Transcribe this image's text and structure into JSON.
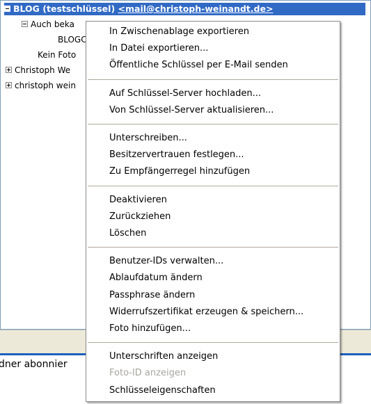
{
  "tree": {
    "rows": [
      {
        "label": "BLOG (testschlüssel)",
        "email": "<mail@christoph-weinandt.de>"
      },
      {
        "label": "Auch beka"
      },
      {
        "label": "BLOGC"
      },
      {
        "label": "Kein Foto"
      },
      {
        "label": "Christoph We"
      },
      {
        "label": "christoph wein"
      }
    ]
  },
  "bottom_text": "dner abonnier",
  "context_menu": {
    "groups": [
      [
        "In Zwischenablage exportieren",
        "In Datei exportieren...",
        "Öffentliche Schlüssel per E-Mail senden"
      ],
      [
        "Auf Schlüssel-Server hochladen...",
        "Von Schlüssel-Server aktualisieren..."
      ],
      [
        "Unterschreiben...",
        "Besitzervertrauen festlegen...",
        "Zu Empfängerregel hinzufügen"
      ],
      [
        "Deaktivieren",
        "Zurückziehen",
        "Löschen"
      ],
      [
        "Benutzer-IDs verwalten...",
        "Ablaufdatum ändern",
        "Passphrase ändern",
        "Widerrufszertifikat erzeugen & speichern...",
        "Foto hinzufügen..."
      ],
      [
        "Unterschriften anzeigen",
        "Foto-ID anzeigen",
        "Schlüsseleigenschaften"
      ]
    ],
    "disabled_items": [
      "Foto-ID anzeigen"
    ]
  },
  "colors": {
    "selection": "#316ac5",
    "separator": "#aca899",
    "disabled_text": "#a7a69e",
    "status_bar": "#ece9d8",
    "blue_line": "#1c5ebe"
  }
}
